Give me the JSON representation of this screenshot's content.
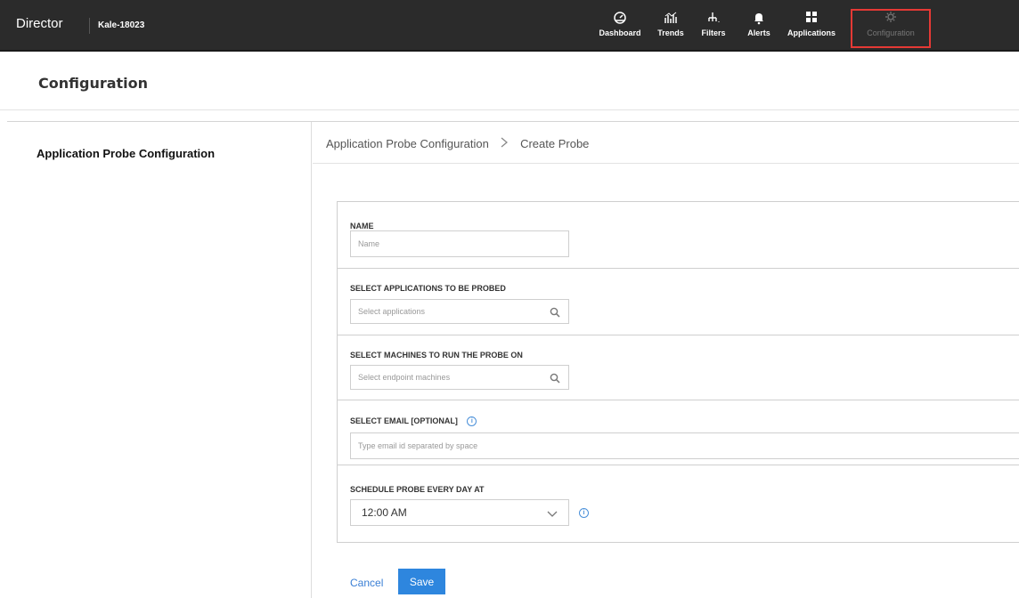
{
  "topbar": {
    "brand": "Director",
    "site": "Kale-18023",
    "nav": [
      {
        "label": "Dashboard",
        "icon": "dashboard-icon"
      },
      {
        "label": "Trends",
        "icon": "trends-icon"
      },
      {
        "label": "Filters",
        "icon": "filters-icon"
      },
      {
        "label": "Alerts",
        "icon": "bell-icon"
      },
      {
        "label": "Applications",
        "icon": "grid-icon"
      },
      {
        "label": "Configuration",
        "icon": "gear-icon"
      }
    ],
    "highlight_color": "#e53935"
  },
  "page": {
    "title": "Configuration"
  },
  "sidebar": {
    "items": [
      {
        "label": "Application Probe Configuration"
      }
    ]
  },
  "breadcrumb": {
    "items": [
      "Application Probe Configuration",
      "Create Probe"
    ]
  },
  "form": {
    "name": {
      "label": "NAME",
      "placeholder": "Name"
    },
    "applications": {
      "label": "SELECT APPLICATIONS TO BE PROBED",
      "placeholder": "Select applications"
    },
    "machines": {
      "label": "SELECT MACHINES TO RUN THE PROBE ON",
      "placeholder": "Select endpoint machines"
    },
    "email": {
      "label": "SELECT EMAIL [OPTIONAL]",
      "placeholder": "Type email id separated by space"
    },
    "schedule": {
      "label": "SCHEDULE PROBE EVERY DAY AT",
      "value": "12:00 AM"
    }
  },
  "actions": {
    "cancel": "Cancel",
    "save": "Save",
    "accent": "#2e86de"
  }
}
